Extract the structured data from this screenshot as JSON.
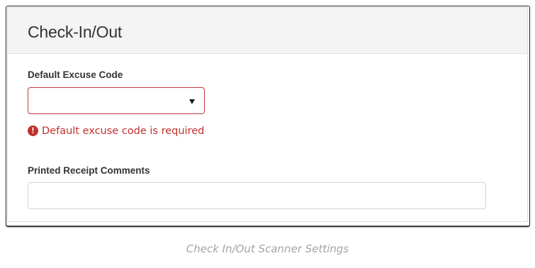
{
  "panel": {
    "title": "Check-In/Out"
  },
  "excuse_code": {
    "label": "Default Excuse Code",
    "selected": "",
    "error_icon_symbol": "!",
    "error": "Default excuse code is required"
  },
  "comments": {
    "label": "Printed Receipt Comments",
    "value": ""
  },
  "caption": "Check In/Out Scanner Settings",
  "colors": {
    "error": "#c0302f",
    "header_bg": "#f4f4f4",
    "caption": "#a4a4a4"
  },
  "icons": {
    "select_caret": "caret-down-icon",
    "error": "exclamation-circle-icon"
  }
}
